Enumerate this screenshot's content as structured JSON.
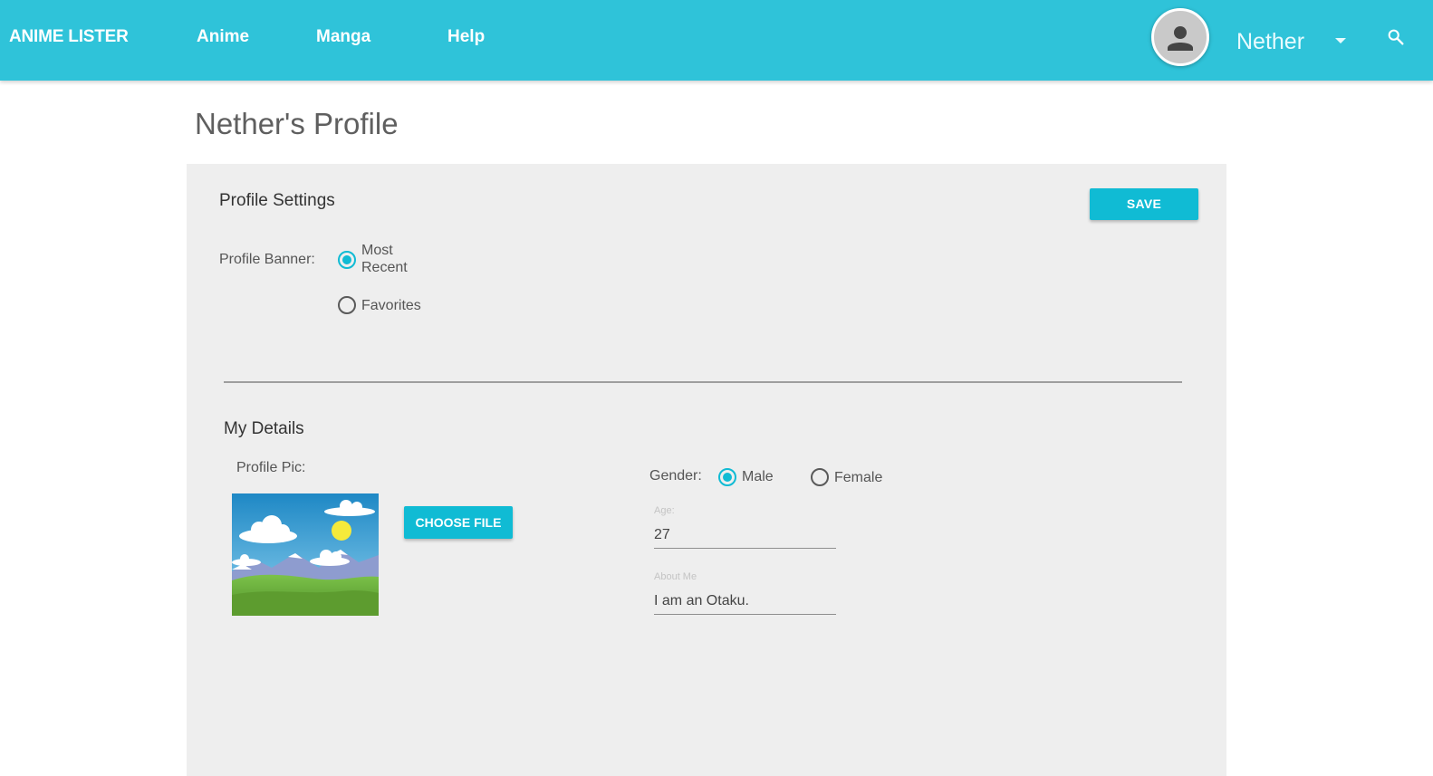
{
  "header": {
    "brand": "ANIME LISTER",
    "nav": [
      {
        "label": "Anime"
      },
      {
        "label": "Manga"
      },
      {
        "label": "Help"
      }
    ],
    "username": "Nether",
    "accent_color": "#2fc3d9"
  },
  "page": {
    "title": "Nether's Profile"
  },
  "settings": {
    "title": "Profile Settings",
    "save_label": "SAVE",
    "banner_label": "Profile Banner:",
    "banner_options": [
      {
        "line1": "Most",
        "line2": "Recent",
        "checked": true
      },
      {
        "label": "Favorites",
        "checked": false
      }
    ]
  },
  "details": {
    "title": "My Details",
    "pic_label": "Profile Pic:",
    "choose_file_label": "CHOOSE FILE",
    "gender_label": "Gender:",
    "gender_options": [
      {
        "label": "Male",
        "checked": true
      },
      {
        "label": "Female",
        "checked": false
      }
    ],
    "age_caption": "Age:",
    "age_value": "27",
    "about_caption": "About Me",
    "about_value": "I am an Otaku."
  },
  "icons": [
    "person-icon",
    "caret-down-icon",
    "search-icon",
    "landscape-image"
  ],
  "button_color": "#10bbd4",
  "card_color": "#eeeeee"
}
